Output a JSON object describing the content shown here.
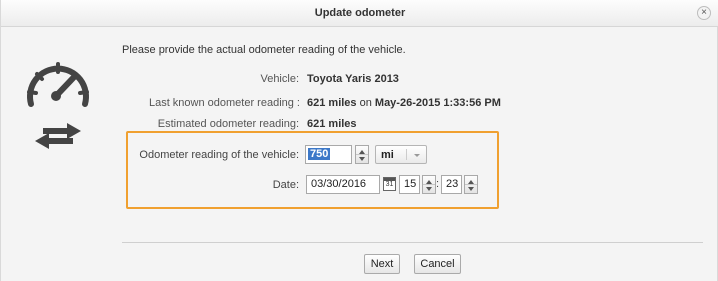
{
  "dialog": {
    "title": "Update odometer",
    "close_glyph": "×",
    "intro": "Please provide the actual odometer reading of the vehicle."
  },
  "info": {
    "vehicle_label": "Vehicle:",
    "vehicle_value": "Toyota Yaris 2013",
    "last_label": "Last known odometer reading :",
    "last_value": "621 miles",
    "last_on": " on ",
    "last_date": "May-26-2015 1:33:56 PM",
    "estimated_label": "Estimated odometer reading:",
    "estimated_value": "621 miles"
  },
  "form": {
    "odometer_label": "Odometer reading of the vehicle:",
    "odometer_value": "750",
    "unit": "mi",
    "date_label": "Date:",
    "date_value": "03/30/2016",
    "calendar_day": "31",
    "hour": "15",
    "minute": "23",
    "time_separator": ":"
  },
  "buttons": {
    "next": "Next",
    "cancel": "Cancel"
  },
  "icons": {
    "main": "speedometer-swap-icon",
    "calendar": "calendar-icon",
    "close": "close-icon"
  },
  "colors": {
    "highlight": "#f0a030",
    "selection": "#3c78c8",
    "icon": "#444444"
  }
}
